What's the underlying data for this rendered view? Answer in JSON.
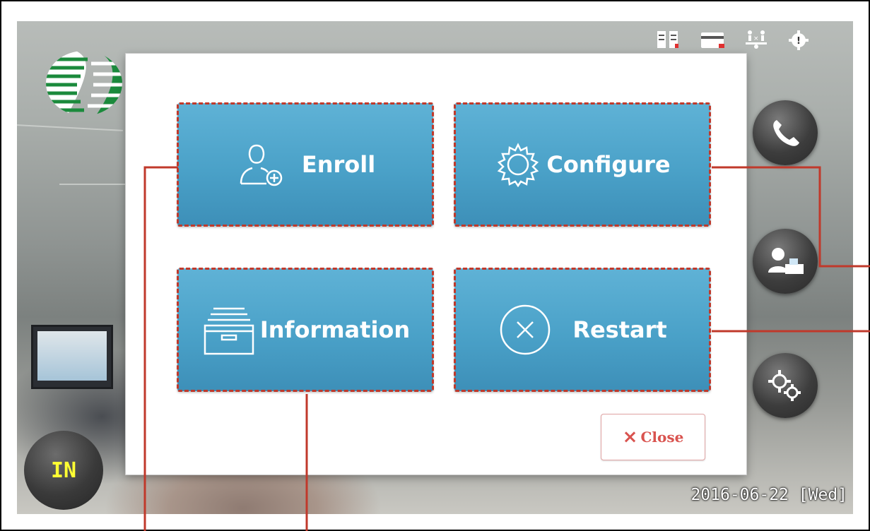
{
  "dialog": {
    "tiles": [
      {
        "label": "Enroll",
        "icon": "user-add-icon"
      },
      {
        "label": "Configure",
        "icon": "gear-icon"
      },
      {
        "label": "Information",
        "icon": "archive-box-icon"
      },
      {
        "label": "Restart",
        "icon": "circle-x-icon"
      }
    ],
    "close_label": "Close"
  },
  "screen": {
    "mode_label": "IN",
    "date": "2016-06-22 [Wed]"
  },
  "status_icons": [
    "server-icon",
    "card-icon",
    "network-icon",
    "alert-gear-icon"
  ],
  "side_buttons": [
    "phone-icon",
    "user-desk-icon",
    "gears-icon"
  ],
  "colors": {
    "tile": "#4aa1c8",
    "tile_outline": "#c0392b",
    "callout_line": "#c0392b",
    "mode_text": "#ffff33",
    "close_text": "#d9534f"
  }
}
